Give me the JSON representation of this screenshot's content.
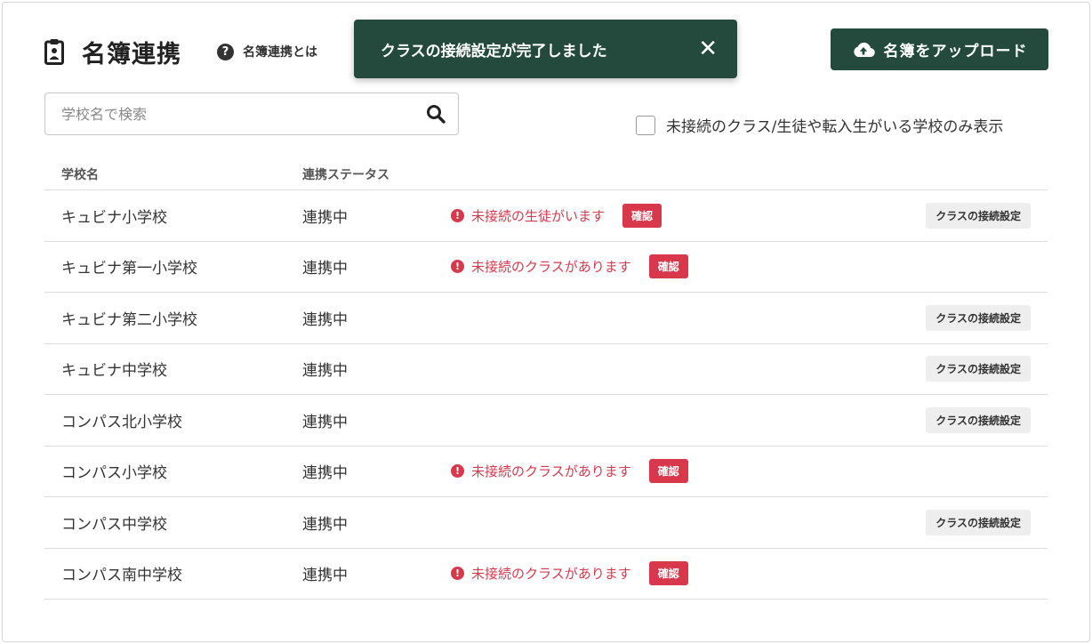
{
  "header": {
    "title": "名簿連携",
    "help_label": "名簿連携とは",
    "help_icon": "question-circle-icon"
  },
  "toast": {
    "message": "クラスの接続設定が完了しました",
    "close_icon": "close-icon"
  },
  "upload": {
    "label": "名簿をアップロード",
    "icon": "cloud-upload-icon"
  },
  "search": {
    "placeholder": "学校名で検索",
    "value": "",
    "icon": "search-icon"
  },
  "filter": {
    "label": "未接続のクラス/生徒や転入生がいる学校のみ表示",
    "checked": false
  },
  "table": {
    "columns": [
      "学校名",
      "連携ステータス"
    ],
    "rows": [
      {
        "school": "キュビナ小学校",
        "status": "連携中",
        "alert": "未接続の生徒がいます",
        "confirm": "確認",
        "action": "クラスの接続設定"
      },
      {
        "school": "キュビナ第一小学校",
        "status": "連携中",
        "alert": "未接続のクラスがあります",
        "confirm": "確認",
        "action": ""
      },
      {
        "school": "キュビナ第二小学校",
        "status": "連携中",
        "alert": "",
        "confirm": "",
        "action": "クラスの接続設定"
      },
      {
        "school": "キュビナ中学校",
        "status": "連携中",
        "alert": "",
        "confirm": "",
        "action": "クラスの接続設定"
      },
      {
        "school": "コンパス北小学校",
        "status": "連携中",
        "alert": "",
        "confirm": "",
        "action": "クラスの接続設定"
      },
      {
        "school": "コンパス小学校",
        "status": "連携中",
        "alert": "未接続のクラスがあります",
        "confirm": "確認",
        "action": ""
      },
      {
        "school": "コンパス中学校",
        "status": "連携中",
        "alert": "",
        "confirm": "",
        "action": "クラスの接続設定"
      },
      {
        "school": "コンパス南中学校",
        "status": "連携中",
        "alert": "未接続のクラスがあります",
        "confirm": "確認",
        "action": ""
      }
    ]
  },
  "colors": {
    "primary": "#234a3c",
    "danger": "#d9384c",
    "action_bg": "#eeeeee"
  }
}
